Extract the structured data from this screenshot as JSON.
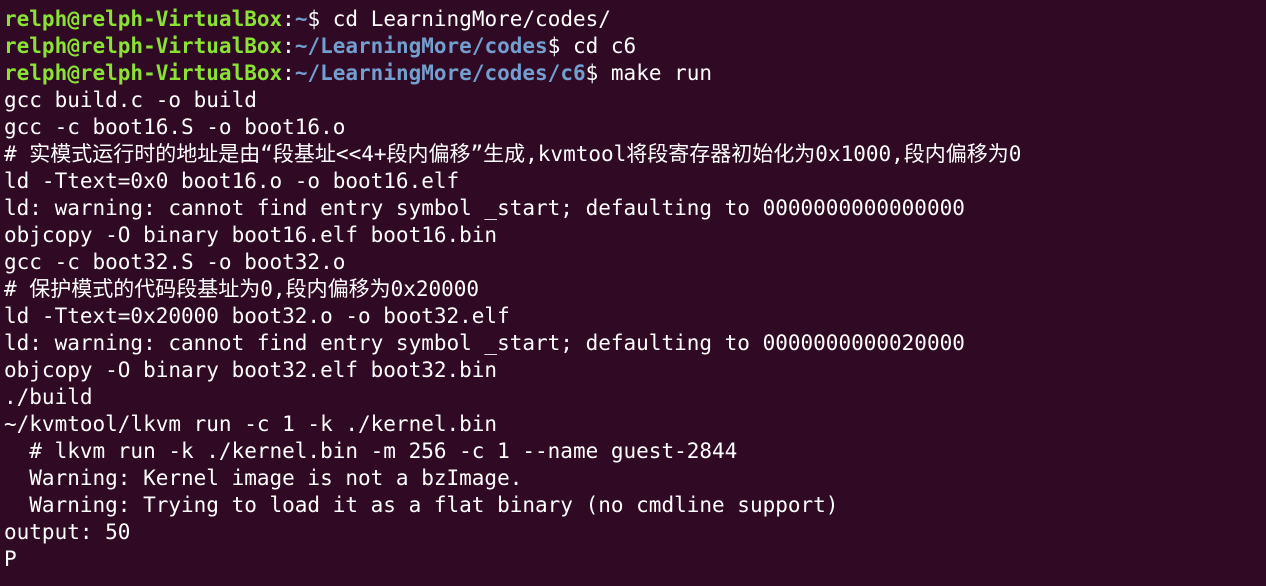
{
  "terminal": {
    "prompts": [
      {
        "user": "relph@relph-VirtualBox",
        "sep": ":",
        "path": "~",
        "dollar": "$ ",
        "cmd": "cd LearningMore/codes/"
      },
      {
        "user": "relph@relph-VirtualBox",
        "sep": ":",
        "path": "~/LearningMore/codes",
        "dollar": "$ ",
        "cmd": "cd c6"
      },
      {
        "user": "relph@relph-VirtualBox",
        "sep": ":",
        "path": "~/LearningMore/codes/c6",
        "dollar": "$ ",
        "cmd": "make run"
      }
    ],
    "output": [
      "gcc build.c -o build",
      "gcc -c boot16.S -o boot16.o",
      "# 实模式运行时的地址是由“段基址<<4+段内偏移”生成,kvmtool将段寄存器初始化为0x1000,段内偏移为0",
      "ld -Ttext=0x0 boot16.o -o boot16.elf",
      "ld: warning: cannot find entry symbol _start; defaulting to 0000000000000000",
      "objcopy -O binary boot16.elf boot16.bin",
      "gcc -c boot32.S -o boot32.o",
      "# 保护模式的代码段基址为0,段内偏移为0x20000",
      "ld -Ttext=0x20000 boot32.o -o boot32.elf",
      "ld: warning: cannot find entry symbol _start; defaulting to 0000000000020000",
      "objcopy -O binary boot32.elf boot32.bin",
      "./build",
      "~/kvmtool/lkvm run -c 1 -k ./kernel.bin",
      "  # lkvm run -k ./kernel.bin -m 256 -c 1 --name guest-2844",
      "  Warning: Kernel image is not a bzImage.",
      "  Warning: Trying to load it as a flat binary (no cmdline support)",
      "output: 50",
      "P"
    ]
  },
  "colors": {
    "background": "#300a24",
    "prompt_user": "#8ae234",
    "prompt_path": "#729fcf",
    "text": "#ffffff"
  }
}
